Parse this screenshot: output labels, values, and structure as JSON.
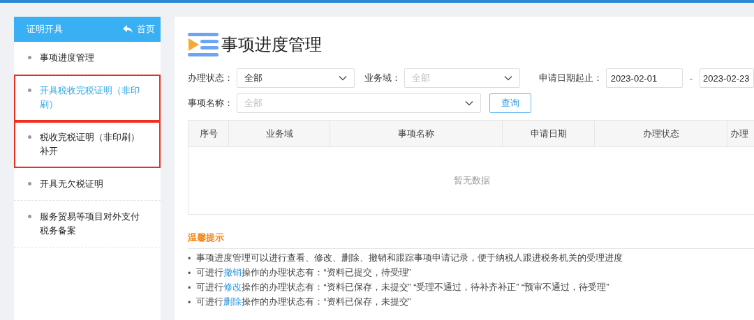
{
  "sidebar": {
    "title": "证明开具",
    "home_label": "首页",
    "items": [
      {
        "label": "事项进度管理",
        "selected": false,
        "highlighted": false
      },
      {
        "label": "开具税收完税证明（非印刷）",
        "selected": true,
        "highlighted": true
      },
      {
        "label": "税收完税证明（非印刷）补开",
        "selected": false,
        "highlighted": true
      },
      {
        "label": "开具无欠税证明",
        "selected": false,
        "highlighted": false
      },
      {
        "label": "服务贸易等项目对外支付税务备案",
        "selected": false,
        "highlighted": false
      }
    ]
  },
  "main": {
    "title": "事项进度管理",
    "filters": {
      "status": {
        "label": "办理状态：",
        "value": "全部"
      },
      "domain": {
        "label": "业务域：",
        "placeholder": "全部"
      },
      "date_range": {
        "label": "申请日期起止：",
        "start": "2023-02-01",
        "separator": "-",
        "end": "2023-02-23"
      },
      "item_name": {
        "label": "事项名称：",
        "placeholder": "全部"
      },
      "query_button": "查询"
    },
    "table": {
      "columns": [
        "序号",
        "业务域",
        "事项名称",
        "申请日期",
        "办理状态",
        "办理"
      ],
      "empty_text": "暂无数据"
    },
    "tips": {
      "title": "温馨提示",
      "bullet": "•",
      "items": [
        {
          "prefix": "事项进度管理可以进行查看、修改、删除、撤销和跟踪事项申请记录，便于纳税人跟进税务机关的受理进度"
        },
        {
          "prefix": "可进行",
          "link": "撤销",
          "suffix": "操作的办理状态有：“资料已提交，待受理”"
        },
        {
          "prefix": "可进行",
          "link": "修改",
          "suffix": "操作的办理状态有：“资料已保存，未提交”  “受理不通过，待补齐补正”  “预审不通过，待受理”"
        },
        {
          "prefix": "可进行",
          "link": "删除",
          "suffix": "操作的办理状态有：“资料已保存，未提交”"
        }
      ]
    }
  }
}
